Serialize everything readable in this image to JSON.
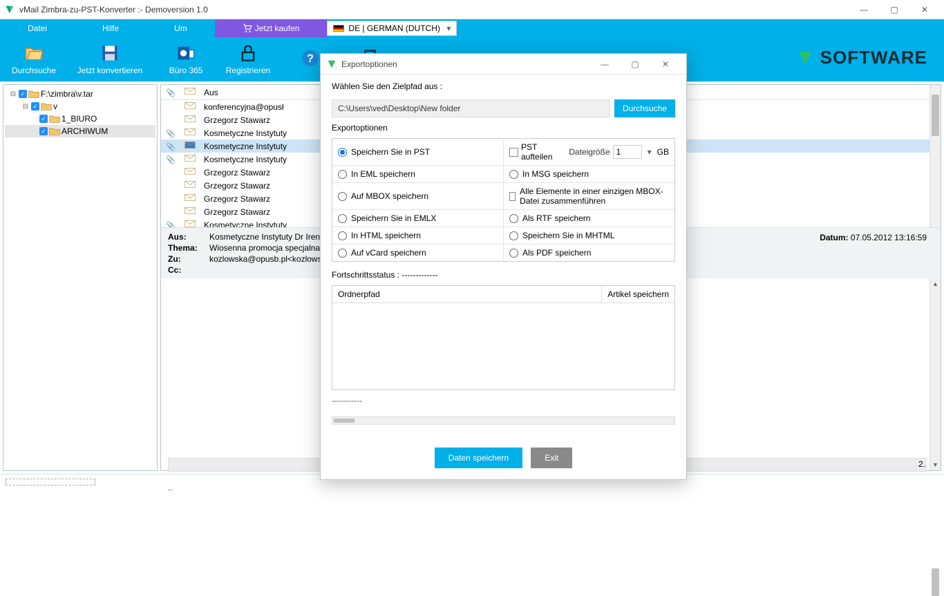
{
  "titlebar": {
    "title": "vMail Zimbra-zu-PST-Konverter :- Demoversion 1.0"
  },
  "menubar": {
    "file": "Datei",
    "help": "Hilfe",
    "about": "Um",
    "buy": "Jetzt kaufen",
    "lang": "DE | GERMAN (DUTCH)"
  },
  "toolbar": {
    "browse": "Durchsuche",
    "convert": "Jetzt konvertieren",
    "office": "Büro 365",
    "register": "Registrieren",
    "help": "",
    "exit": "",
    "brand": "SOFTWARE"
  },
  "tree": {
    "items": [
      {
        "label": "F:\\zimbra\\v.tar",
        "level": 0,
        "twisty": "⊟"
      },
      {
        "label": "v",
        "level": 1,
        "twisty": "⊟"
      },
      {
        "label": "1_BIURO",
        "level": 2,
        "twisty": ""
      },
      {
        "label": "ARCHIWUM",
        "level": 2,
        "twisty": "",
        "sel": true
      }
    ]
  },
  "maillist": {
    "headers": {
      "attach": "",
      "read": "",
      "from": "Aus"
    },
    "rows": [
      {
        "att": false,
        "from": "konferencyjna@opusł"
      },
      {
        "att": false,
        "from": "Grzegorz Stawarz<grz"
      },
      {
        "att": true,
        "from": "Kosmetyczne Instytuty"
      },
      {
        "att": true,
        "from": "Kosmetyczne Instytuty",
        "sel": true
      },
      {
        "att": true,
        "from": "Kosmetyczne Instytuty"
      },
      {
        "att": false,
        "from": "Grzegorz Stawarz<grz"
      },
      {
        "att": false,
        "from": "Grzegorz Stawarz<grz"
      },
      {
        "att": false,
        "from": "Grzegorz Stawarz<grz"
      },
      {
        "att": false,
        "from": "Grzegorz Stawarz<grz"
      },
      {
        "att": true,
        "from": "Kosmetyczne Instytuty"
      }
    ]
  },
  "detail": {
    "from_label": "Aus:",
    "from": "Kosmetyczne Instytuty Dr Irena Eris",
    "subject_label": "Thema:",
    "subject": "Wiosenna promocja specjalna!",
    "to_label": "Zu:",
    "to": "kozlowska@opusb.pl<kozlowska@",
    "cc_label": "Cc:",
    "cc": "",
    "date_label": "Datum:",
    "date": "07.05.2012 13:16:59",
    "more1": "..",
    "more2": "2.",
    "dashes": "-----------"
  },
  "modal": {
    "title": "Exportoptionen",
    "choose_path": "Wählen Sie den Zielpfad aus :",
    "path": "C:\\Users\\ved\\Desktop\\New folder",
    "browse": "Durchsuche",
    "options_label": "Exportoptionen",
    "opts": {
      "pst": "Speichern Sie in PST",
      "split": "PST aufteilen",
      "filesize": "Dateigröße",
      "filesize_val": "1",
      "gb": "GB",
      "eml": "In EML speichern",
      "msg": "In MSG speichern",
      "mbox": "Auf MBOX speichern",
      "mbox_single": "Alle Elemente in einer einzigen MBOX-Datei zusammenführen",
      "emlx": "Speichern Sie in EMLX",
      "rtf": "Als RTF speichern",
      "html": "In HTML speichern",
      "mhtml": "Speichern Sie in MHTML",
      "vcard": "Auf vCard speichern",
      "pdf": "Als PDF speichern"
    },
    "progress_label": "Fortschrittsstatus : -------------",
    "prog_headers": {
      "path": "Ordnerpfad",
      "save": "Artikel speichern"
    },
    "hscroll_dashes": "-----------",
    "save_btn": "Daten speichern",
    "exit_btn": "Exit"
  }
}
